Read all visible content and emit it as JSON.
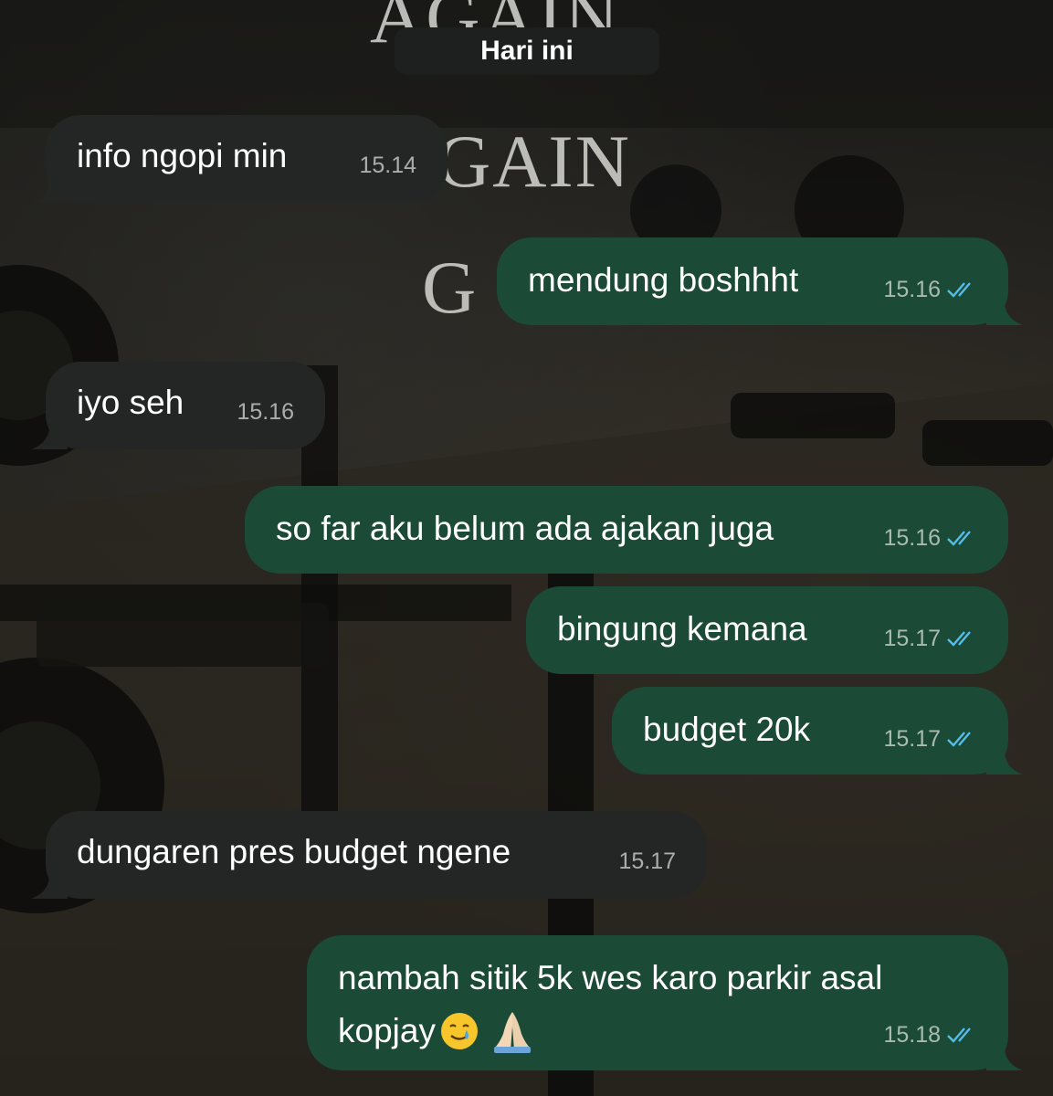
{
  "wallpaper": {
    "text_lines": [
      "AGAIN",
      "GAIN",
      "G"
    ]
  },
  "date_separator": "Hari ini",
  "messages": [
    {
      "direction": "incoming",
      "text": "info ngopi min",
      "time": "15.14"
    },
    {
      "direction": "outgoing",
      "text": "mendung boshhht",
      "time": "15.16",
      "status": "read"
    },
    {
      "direction": "incoming",
      "text": "iyo seh",
      "time": "15.16"
    },
    {
      "direction": "outgoing",
      "text": "so far aku belum ada ajakan juga",
      "time": "15.16",
      "status": "read"
    },
    {
      "direction": "outgoing",
      "text": "bingung kemana",
      "time": "15.17",
      "status": "read"
    },
    {
      "direction": "outgoing",
      "text": "budget 20k",
      "time": "15.17",
      "status": "read"
    },
    {
      "direction": "incoming",
      "text": "dungaren pres budget ngene",
      "time": "15.17"
    },
    {
      "direction": "outgoing",
      "text_line1": "nambah sitik 5k wes karo parkir asal",
      "text_line2": "kopjay",
      "emojis": [
        "smiling-face-with-tear",
        "folded-hands"
      ],
      "time": "15.18",
      "status": "read"
    }
  ],
  "colors": {
    "incoming_bubble": "#242626",
    "outgoing_bubble": "#1b4a36",
    "read_ticks": "#53bdeb",
    "date_pill": "#1e1f1f"
  }
}
